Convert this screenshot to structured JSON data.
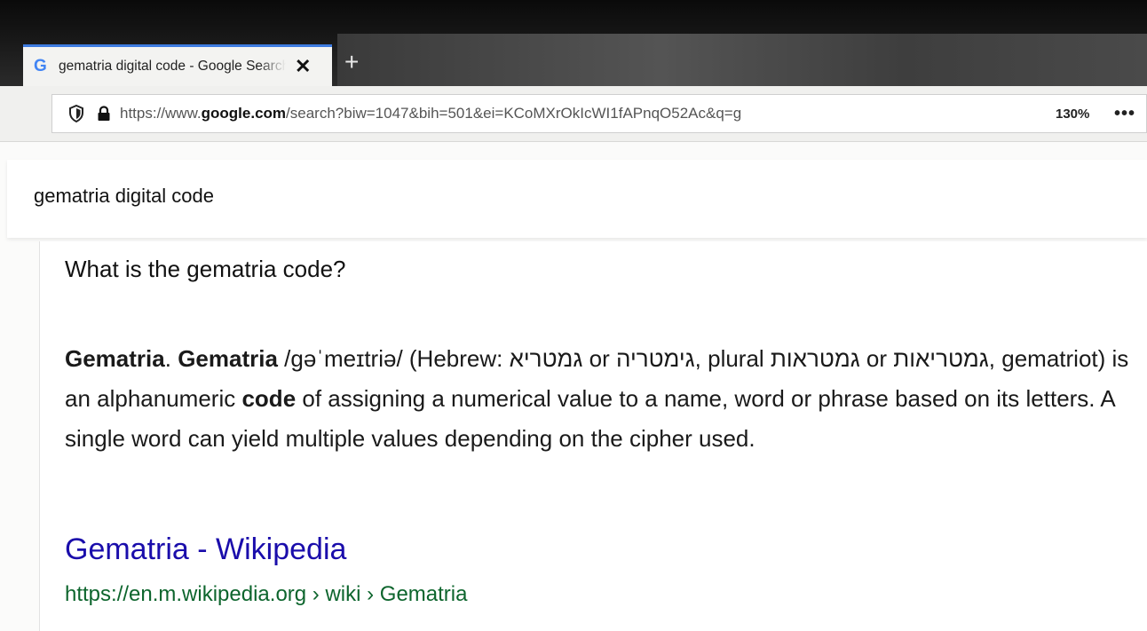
{
  "browser": {
    "tab": {
      "favicon": "G",
      "title": "gematria digital code - Google Search",
      "close": "✕"
    },
    "new_tab": "+",
    "url_prefix": "https://www.",
    "url_domain": "google.com",
    "url_rest": "/search?biw=1047&bih=501&ei=KCoMXrOkIcWI1fAPnqO52Ac&q=g",
    "zoom": "130%",
    "menu": "•••",
    "icons": [
      "shield-icon",
      "lock-icon",
      "close-icon",
      "plus-icon",
      "more-icon"
    ]
  },
  "search": {
    "query": "gematria digital code"
  },
  "answer": {
    "question": "What is the gematria code?",
    "term1": "Gematria",
    "sep1": ". ",
    "term2": "Gematria",
    "text1": " /ɡəˈmeɪtriə/ (Hebrew: גמטריא or גימטריה, plural גמטראות or גמטריאות, gematriot) is an alphanumeric ",
    "term3": "code",
    "text2": " of assigning a numerical value to a name, word or phrase based on its letters. A single word can yield multiple values depending on the cipher used."
  },
  "result": {
    "title": "Gematria - Wikipedia",
    "url": "https://en.m.wikipedia.org › wiki › Gematria"
  },
  "colors": {
    "link": "#1a0dab",
    "url_green": "#0d652d",
    "tab_accent": "#3d7be0"
  }
}
